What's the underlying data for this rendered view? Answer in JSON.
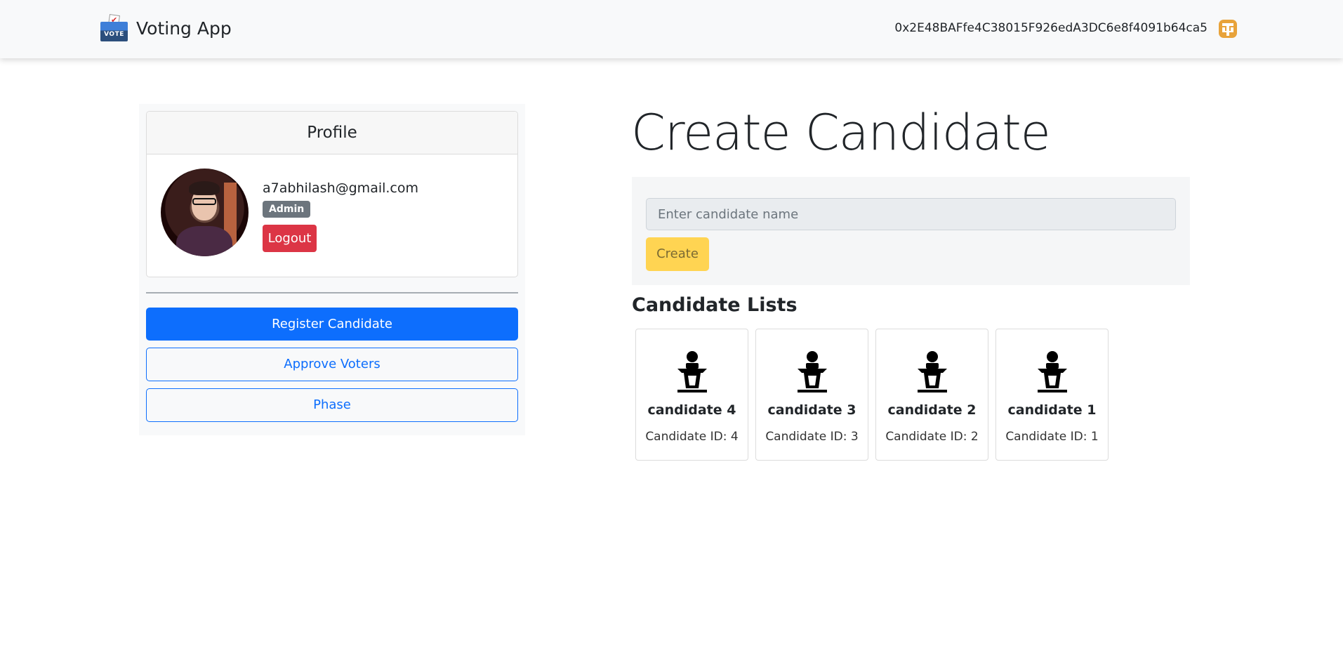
{
  "navbar": {
    "brand_name": "Voting App",
    "logo_text": "VOTE",
    "account_address": "0x2E48BAFfe4C38015F926edA3DC6e8f4091b64ca5"
  },
  "profile": {
    "header": "Profile",
    "email": "a7abhilash@gmail.com",
    "role_badge": "Admin",
    "logout_label": "Logout"
  },
  "sidebar": {
    "register_candidate": "Register Candidate",
    "approve_voters": "Approve Voters",
    "phase": "Phase"
  },
  "create": {
    "title": "Create Candidate",
    "input_placeholder": "Enter candidate name",
    "button_label": "Create"
  },
  "candidates": {
    "title": "Candidate Lists",
    "items": [
      {
        "name": "candidate 4",
        "id_label": "Candidate ID: 4"
      },
      {
        "name": "candidate 3",
        "id_label": "Candidate ID: 3"
      },
      {
        "name": "candidate 2",
        "id_label": "Candidate ID: 2"
      },
      {
        "name": "candidate 1",
        "id_label": "Candidate ID: 1"
      }
    ]
  },
  "colors": {
    "primary": "#0d6efd",
    "danger": "#dc3545",
    "warning": "#ffd452",
    "secondary": "#6c757d",
    "identicon": "#e8a33a"
  }
}
